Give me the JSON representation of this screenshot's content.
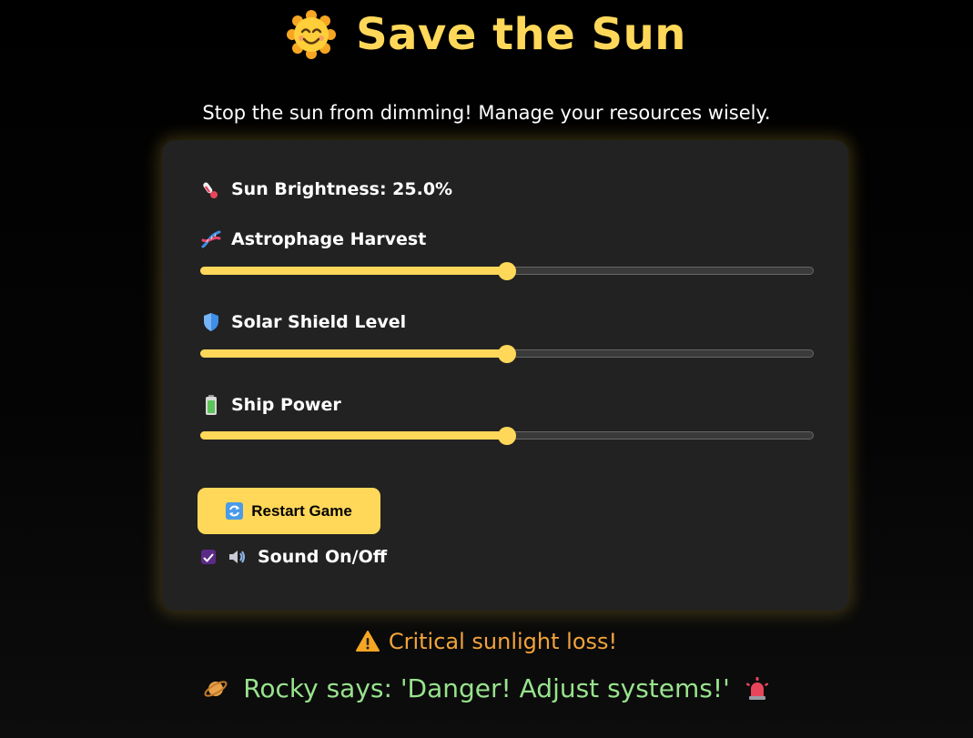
{
  "header": {
    "sun_icon": "smiling-sun-icon",
    "title": "Save the Sun",
    "subtitle": "Stop the sun from dimming! Manage your resources wisely."
  },
  "stats": {
    "brightness_icon": "thermometer-icon",
    "brightness_label": "Sun Brightness: 25.0%"
  },
  "controls": [
    {
      "icon": "dna-icon",
      "label": "Astrophage Harvest",
      "value": 0.5
    },
    {
      "icon": "shield-icon",
      "label": "Solar Shield Level",
      "value": 0.5
    },
    {
      "icon": "battery-icon",
      "label": "Ship Power",
      "value": 0.5
    }
  ],
  "restart": {
    "icon": "refresh-icon",
    "label": "Restart Game"
  },
  "sound": {
    "checked": true,
    "icon": "speaker-icon",
    "label": "Sound On/Off"
  },
  "status": {
    "warning_icon": "warning-icon",
    "warning": "Critical sunlight loss!",
    "planet_icon": "ringed-planet-icon",
    "rocky_message": "Rocky says: 'Danger! Adjust systems!'",
    "alarm_icon": "siren-icon"
  },
  "colors": {
    "accent": "#ffd859",
    "panel": "#222222",
    "warning": "#f2a33a",
    "message": "#98e38d",
    "checkbox": "#5b2a86"
  }
}
